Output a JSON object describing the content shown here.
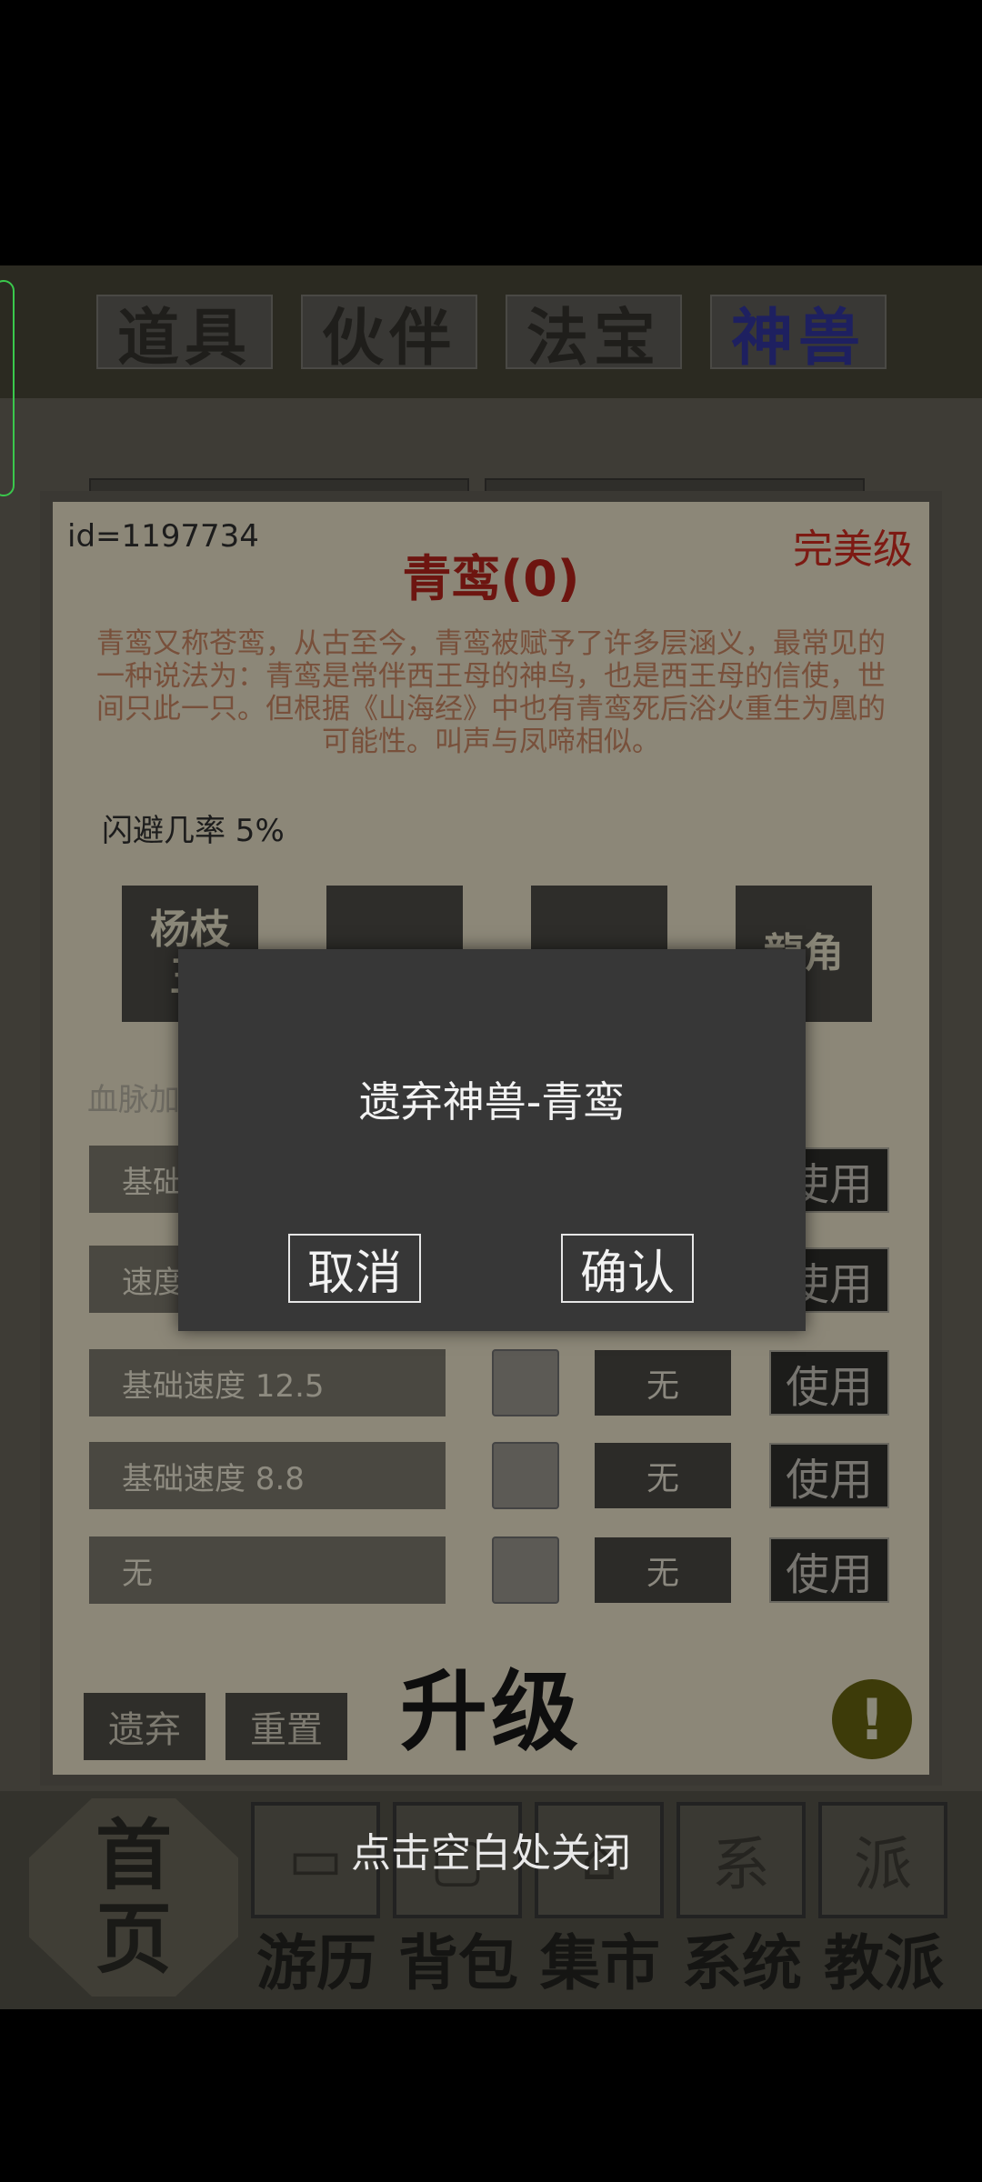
{
  "top_tabs": [
    {
      "label": "道具",
      "active": false
    },
    {
      "label": "伙伴",
      "active": false
    },
    {
      "label": "法宝",
      "active": false
    },
    {
      "label": "神兽",
      "active": true
    }
  ],
  "pet": {
    "id_text": "id=1197734",
    "grade": "完美级",
    "name": "青鸾(0)",
    "description": "青鸾又称苍鸾，从古至今，青鸾被赋予了许多层涵义，最常见的一种说法为：青鸾是常伴西王母的神鸟，也是西王母的信使，世间只此一只。但根据《山海经》中也有青鸾死后浴火重生为凰的可能性。叫声与凤啼相似。",
    "skill_text": "闪避几率 5%"
  },
  "skills": [
    "杨枝\n玉",
    "",
    "",
    "龍角"
  ],
  "bloodline_label": "血脉加",
  "rows": [
    {
      "name": "基础",
      "state": "",
      "use": "使用"
    },
    {
      "name": "速度",
      "state": "",
      "use": "使用"
    },
    {
      "name": "基础速度 12.5",
      "state": "无",
      "use": "使用"
    },
    {
      "name": "基础速度 8.8",
      "state": "无",
      "use": "使用"
    },
    {
      "name": "无",
      "state": "无",
      "use": "使用"
    }
  ],
  "actions": {
    "discard": "遗弃",
    "reset": "重置",
    "upgrade": "升级",
    "info": "!"
  },
  "nav": {
    "home": "首\n页",
    "items": [
      {
        "label": "游历",
        "icon": "treasure-chest-icon"
      },
      {
        "label": "背包",
        "icon": "bag-icon"
      },
      {
        "label": "集市",
        "icon": "market-icon"
      },
      {
        "label": "系统",
        "icon": "system-icon"
      },
      {
        "label": "教派",
        "icon": "sect-icon"
      }
    ],
    "icon_glyphs": [
      "▭",
      "▢",
      "⌂",
      "系",
      "派"
    ],
    "close_hint": "点击空白处关闭"
  },
  "dialog": {
    "title": "遗弃神兽-青鸾",
    "cancel": "取消",
    "confirm": "确认"
  }
}
